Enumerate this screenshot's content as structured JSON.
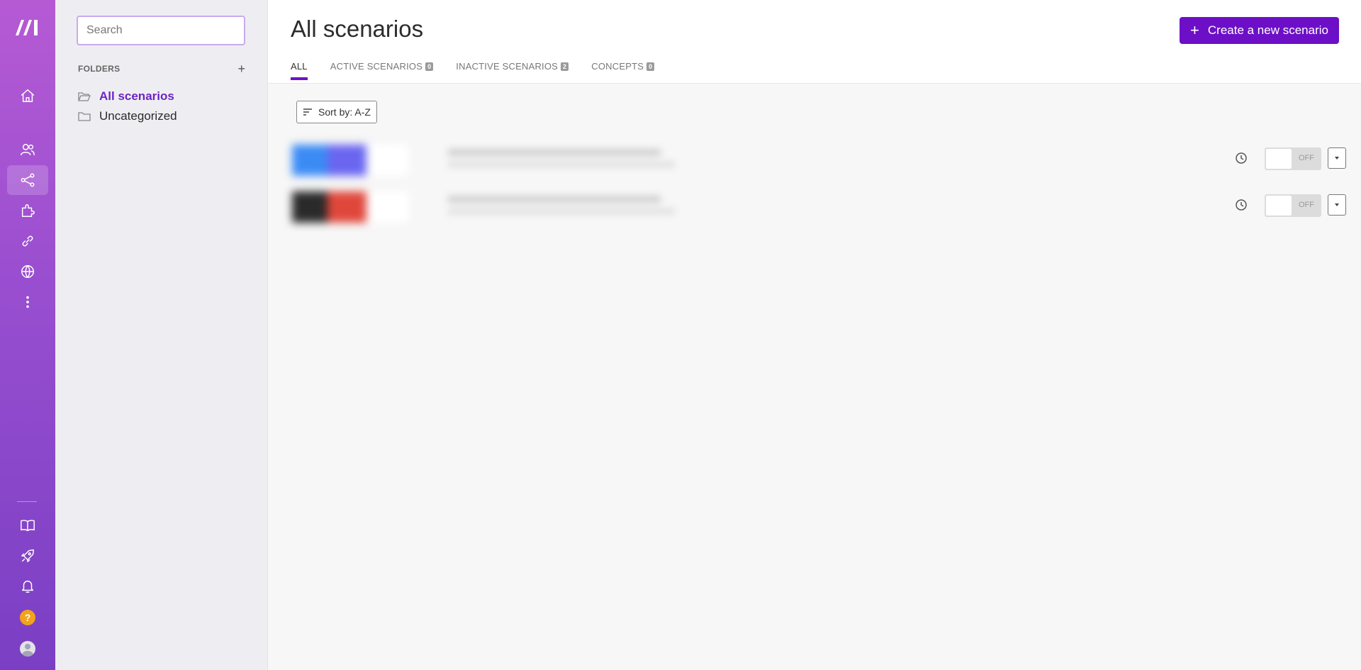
{
  "sidebar": {
    "search_placeholder": "Search",
    "folders_label": "FOLDERS",
    "add_label": "+",
    "folders": [
      {
        "label": "All scenarios",
        "active": true
      },
      {
        "label": "Uncategorized",
        "active": false
      }
    ]
  },
  "rail": {
    "brand": "make-logo",
    "items": [
      "home-icon",
      "team-icon",
      "scenarios-icon",
      "apps-icon",
      "connections-icon",
      "webhooks-icon",
      "more-icon"
    ],
    "bottom": [
      "docs-icon",
      "rocket-icon",
      "bell-icon",
      "help-icon",
      "avatar"
    ],
    "help_label": "?"
  },
  "header": {
    "title": "All scenarios",
    "create_label": "Create a new scenario",
    "create_plus": "+",
    "tabs": [
      {
        "label": "ALL",
        "count": null,
        "active": true
      },
      {
        "label": "ACTIVE SCENARIOS",
        "count": "0"
      },
      {
        "label": "INACTIVE SCENARIOS",
        "count": "2"
      },
      {
        "label": "CONCEPTS",
        "count": "0"
      }
    ]
  },
  "list": {
    "sort_label": "Sort by: A-Z",
    "scenarios": [
      {
        "toggle_label": "OFF",
        "colors": [
          "#3b8bf5",
          "#6a66f0"
        ]
      },
      {
        "toggle_label": "OFF",
        "colors": [
          "#2a2a2a",
          "#e0473b"
        ]
      }
    ]
  },
  "colors": {
    "accent": "#6d0fc7",
    "rail_top": "#b65ad4",
    "rail_bottom": "#7a3fc4"
  }
}
